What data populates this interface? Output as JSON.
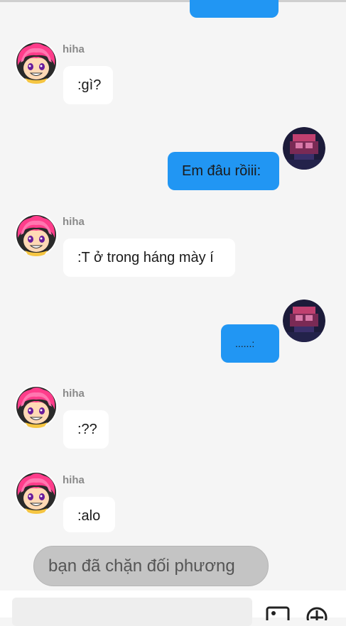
{
  "messages": [
    {
      "side": "in",
      "sender": "hiha",
      "text": ":gì?"
    },
    {
      "side": "out",
      "text": "Em đâu rồiii:"
    },
    {
      "side": "in",
      "sender": "hiha",
      "text": ":T ở trong háng mày í"
    },
    {
      "side": "out",
      "text": "......:"
    },
    {
      "side": "in",
      "sender": "hiha",
      "text": ":??"
    },
    {
      "side": "in",
      "sender": "hiha",
      "text": ":alo"
    }
  ],
  "blocked_notice": "bạn đã chặn đối phương",
  "composer": {
    "input_value": "",
    "image_icon": "image-icon",
    "add_icon": "plus-circle-icon"
  },
  "colors": {
    "outgoing_bubble": "#2196f3",
    "incoming_bubble": "#ffffff",
    "background": "#f5f5f5",
    "blocked_pill": "#c4c4c4"
  }
}
